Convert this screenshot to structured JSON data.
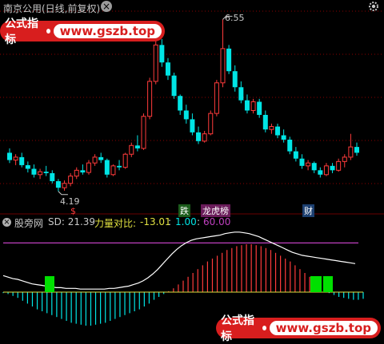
{
  "header": {
    "title": "南京公用(日线,前复权)",
    "close_glyph": "×"
  },
  "badges": {
    "top": {
      "label": "公式指标",
      "url": "www.gszb.top"
    },
    "bottom": {
      "label": "公式指标",
      "url": "www.gszb.top"
    }
  },
  "price_labels": {
    "high": "6.55",
    "low": "4.19"
  },
  "event_tags": {
    "t1": "$",
    "t2": "跌",
    "t3": "龙虎榜",
    "t4": "财"
  },
  "indicator": {
    "name": "股旁网",
    "sd_label": "SD: 21.39",
    "ratio_label": "力量对比:",
    "ratio_value": "-13.01",
    "sep": ":",
    "v1": "1.00",
    "v2": "60.00"
  },
  "colors": {
    "up": "#ff3b3b",
    "down": "#00e5e5",
    "grid": "#8b0000",
    "ma": "#ffffff",
    "purple": "#c040c0",
    "yellow": "#e0e040",
    "green": "#00e000"
  },
  "chart_data": [
    {
      "type": "candlestick",
      "title": "南京公用(日线,前复权)",
      "annotated_high": 6.55,
      "annotated_low": 4.19,
      "candles": [
        [
          4.72,
          4.78,
          4.58,
          4.62
        ],
        [
          4.62,
          4.7,
          4.55,
          4.66
        ],
        [
          4.66,
          4.72,
          4.52,
          4.55
        ],
        [
          4.55,
          4.6,
          4.45,
          4.5
        ],
        [
          4.5,
          4.56,
          4.38,
          4.42
        ],
        [
          4.42,
          4.5,
          4.36,
          4.46
        ],
        [
          4.46,
          4.54,
          4.4,
          4.44
        ],
        [
          4.44,
          4.48,
          4.3,
          4.33
        ],
        [
          4.33,
          4.36,
          4.19,
          4.24
        ],
        [
          4.24,
          4.34,
          4.2,
          4.3
        ],
        [
          4.3,
          4.44,
          4.26,
          4.4
        ],
        [
          4.4,
          4.52,
          4.36,
          4.48
        ],
        [
          4.48,
          4.56,
          4.42,
          4.45
        ],
        [
          4.45,
          4.62,
          4.42,
          4.58
        ],
        [
          4.58,
          4.7,
          4.54,
          4.66
        ],
        [
          4.66,
          4.72,
          4.58,
          4.62
        ],
        [
          4.62,
          4.64,
          4.38,
          4.42
        ],
        [
          4.42,
          4.56,
          4.4,
          4.54
        ],
        [
          4.54,
          4.62,
          4.48,
          4.52
        ],
        [
          4.52,
          4.72,
          4.5,
          4.7
        ],
        [
          4.7,
          4.86,
          4.66,
          4.82
        ],
        [
          4.82,
          4.96,
          4.74,
          4.78
        ],
        [
          4.78,
          5.26,
          4.76,
          5.22
        ],
        [
          5.22,
          5.75,
          5.18,
          5.7
        ],
        [
          5.7,
          6.3,
          5.66,
          6.2
        ],
        [
          6.2,
          6.28,
          5.9,
          5.96
        ],
        [
          5.96,
          6.02,
          5.72,
          5.78
        ],
        [
          5.78,
          5.82,
          5.46,
          5.5
        ],
        [
          5.5,
          5.52,
          5.24,
          5.3
        ],
        [
          5.3,
          5.38,
          5.12,
          5.18
        ],
        [
          5.18,
          5.26,
          4.96,
          5.0
        ],
        [
          5.0,
          5.08,
          4.84,
          4.88
        ],
        [
          4.88,
          5.02,
          4.86,
          4.98
        ],
        [
          4.98,
          5.3,
          4.96,
          5.26
        ],
        [
          5.26,
          5.72,
          5.22,
          5.68
        ],
        [
          5.68,
          6.55,
          5.62,
          6.15
        ],
        [
          6.15,
          6.2,
          5.8,
          5.84
        ],
        [
          5.84,
          5.92,
          5.56,
          5.62
        ],
        [
          5.62,
          5.7,
          5.4,
          5.44
        ],
        [
          5.44,
          5.52,
          5.26,
          5.3
        ],
        [
          5.3,
          5.46,
          5.26,
          5.42
        ],
        [
          5.42,
          5.46,
          5.2,
          5.24
        ],
        [
          5.24,
          5.3,
          5.0,
          5.04
        ],
        [
          5.04,
          5.12,
          4.98,
          5.08
        ],
        [
          5.08,
          5.12,
          4.92,
          4.96
        ],
        [
          4.96,
          5.04,
          4.86,
          4.9
        ],
        [
          4.9,
          4.94,
          4.7,
          4.74
        ],
        [
          4.74,
          4.8,
          4.6,
          4.64
        ],
        [
          4.64,
          4.7,
          4.5,
          4.54
        ],
        [
          4.54,
          4.62,
          4.48,
          4.58
        ],
        [
          4.58,
          4.6,
          4.44,
          4.48
        ],
        [
          4.48,
          4.52,
          4.38,
          4.42
        ],
        [
          4.42,
          4.58,
          4.4,
          4.54
        ],
        [
          4.54,
          4.58,
          4.44,
          4.48
        ],
        [
          4.48,
          4.64,
          4.46,
          4.6
        ],
        [
          4.6,
          4.7,
          4.52,
          4.66
        ],
        [
          4.66,
          4.98,
          4.62,
          4.8
        ],
        [
          4.8,
          4.86,
          4.68,
          4.72
        ]
      ]
    },
    {
      "type": "bar",
      "title": "股旁网",
      "sd": 21.39,
      "force_ratio": -13.01,
      "v1": 1.0,
      "v2": 60.0,
      "bars": [
        -1,
        -2,
        -4,
        -6,
        -9,
        -12,
        -15,
        -18,
        -20,
        -22,
        -24,
        -26,
        -28,
        -30,
        -32,
        -33,
        -34,
        -35,
        -35,
        -34,
        -33,
        -32,
        -30,
        -28,
        -26,
        -24,
        -22,
        -20,
        -18,
        -15,
        -12,
        -8,
        -5,
        -2,
        1,
        4,
        8,
        12,
        16,
        20,
        24,
        28,
        32,
        35,
        38,
        41,
        44,
        46,
        48,
        49,
        50,
        50,
        49,
        48,
        46,
        44,
        41,
        38,
        35,
        32,
        28,
        24,
        20,
        16,
        12,
        8,
        4,
        -1,
        -3,
        -5,
        -6,
        -7,
        -8,
        -8,
        -7
      ],
      "line": [
        22,
        20,
        18,
        17,
        15,
        13,
        11,
        10,
        9,
        8,
        7,
        6,
        6,
        5,
        5,
        5,
        4,
        4,
        4,
        4,
        4,
        4,
        5,
        5,
        6,
        7,
        8,
        10,
        12,
        15,
        19,
        24,
        30,
        37,
        44,
        51,
        57,
        62,
        66,
        69,
        71,
        72,
        73,
        74,
        75,
        76,
        78,
        79,
        80,
        80,
        79,
        78,
        76,
        74,
        71,
        68,
        65,
        62,
        59,
        56,
        53,
        51,
        49,
        48,
        47,
        46,
        45,
        44,
        43,
        42,
        41,
        40,
        39,
        38
      ],
      "purple_level": 70,
      "green_blocks": [
        3,
        52,
        54
      ]
    }
  ]
}
